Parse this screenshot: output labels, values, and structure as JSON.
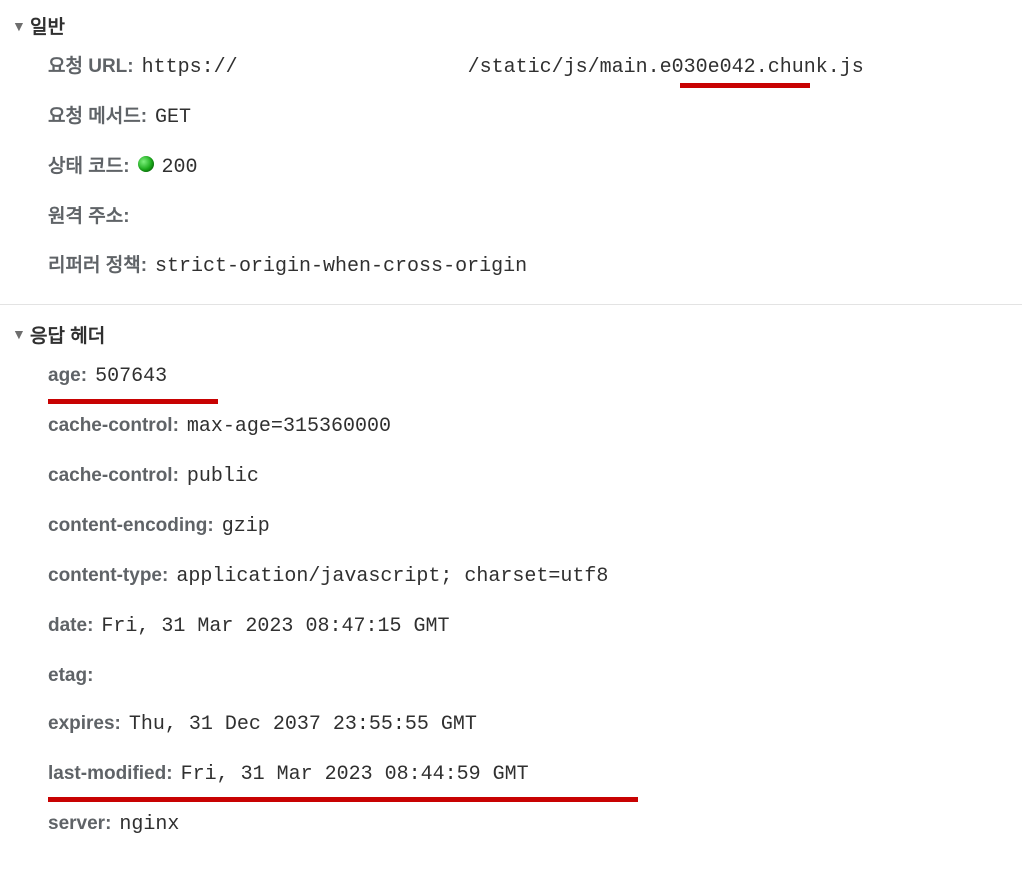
{
  "sections": {
    "general": {
      "title": "일반",
      "rows": {
        "requestUrl": {
          "label": "요청 URL",
          "value_prefix": "https://",
          "value_suffix": "/static/js/main.e030e042.chunk.js"
        },
        "requestMethod": {
          "label": "요청 메서드",
          "value": "GET"
        },
        "statusCode": {
          "label": "상태 코드",
          "value": "200"
        },
        "remoteAddress": {
          "label": "원격 주소",
          "value": ""
        },
        "referrerPolicy": {
          "label": "리퍼러 정책",
          "value": "strict-origin-when-cross-origin"
        }
      }
    },
    "responseHeaders": {
      "title": "응답 헤더",
      "rows": {
        "age": {
          "label": "age",
          "value": "507643"
        },
        "cacheControl1": {
          "label": "cache-control",
          "value": "max-age=315360000"
        },
        "cacheControl2": {
          "label": "cache-control",
          "value": "public"
        },
        "contentEncoding": {
          "label": "content-encoding",
          "value": "gzip"
        },
        "contentType": {
          "label": "content-type",
          "value": "application/javascript; charset=utf8"
        },
        "date": {
          "label": "date",
          "value": "Fri, 31 Mar 2023 08:47:15 GMT"
        },
        "etag": {
          "label": "etag",
          "value": ""
        },
        "expires": {
          "label": "expires",
          "value": "Thu, 31 Dec 2037 23:55:55 GMT"
        },
        "lastModified": {
          "label": "last-modified",
          "value": "Fri, 31 Mar 2023 08:44:59 GMT"
        },
        "server": {
          "label": "server",
          "value": "nginx"
        }
      }
    }
  }
}
